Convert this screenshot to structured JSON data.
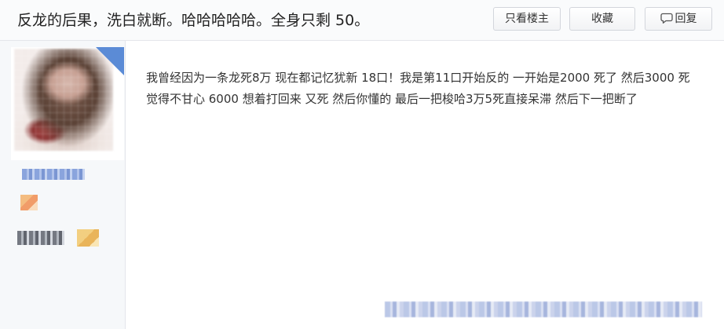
{
  "thread": {
    "title": "反龙的后果，洗白就断。哈哈哈哈哈。全身只剩 50。"
  },
  "toolbar": {
    "only_op_label": "只看楼主",
    "favorite_label": "收藏",
    "reply_label": "回复"
  },
  "post": {
    "content": "我曾经因为一条龙死8万 现在都记忆犹新 18口！我是第11口开始反的 一开始是2000 死了 然后3000 死 觉得不甘心 6000 想着打回来 又死 然后你懂的 最后一把梭哈3万5死直接呆滞 然后下一把断了"
  },
  "colors": {
    "accent": "#5b8bd6",
    "header_bg": "#fafbfc",
    "sidebar_bg": "#f6f8fa"
  },
  "icons": {
    "reply": "chat-bubble-icon"
  }
}
